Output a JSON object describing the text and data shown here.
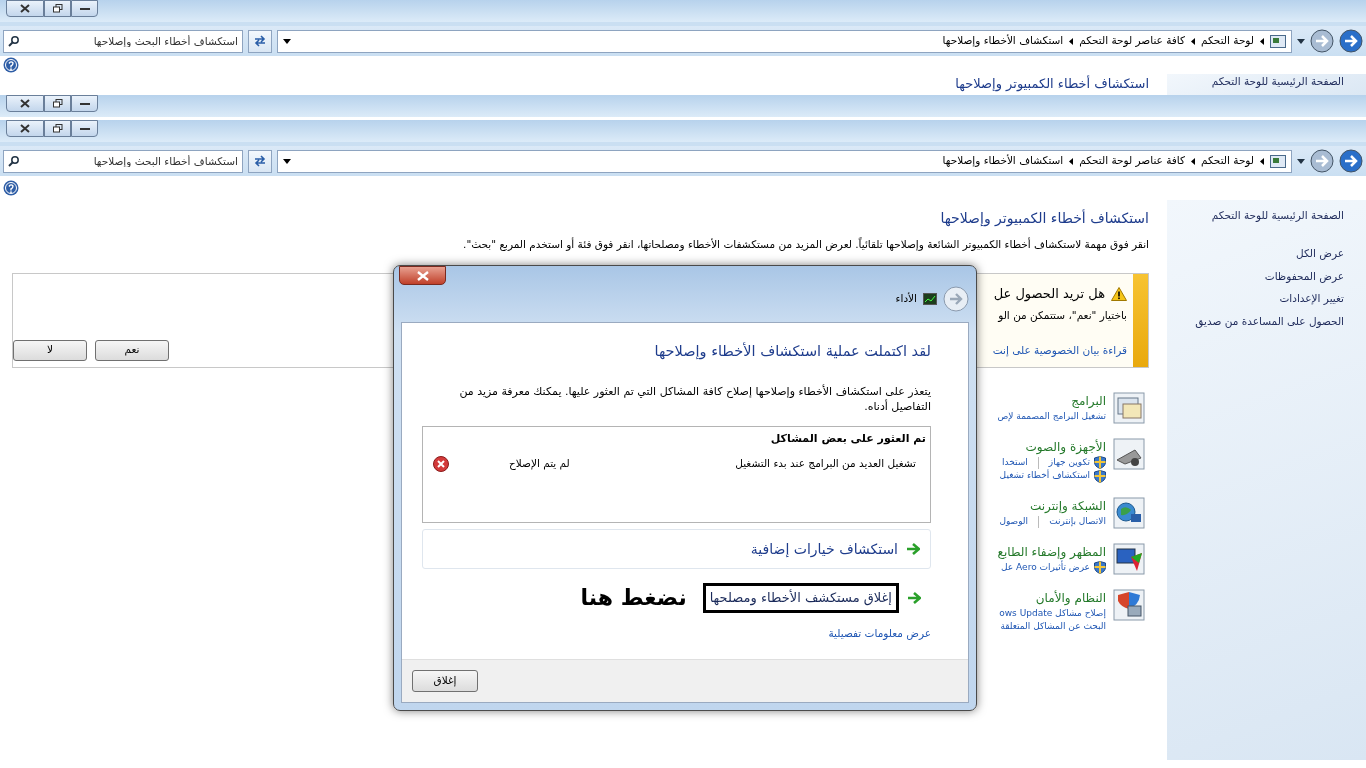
{
  "back_window": {
    "breadcrumbs": [
      "لوحة التحكم",
      "كافة عناصر لوحة التحكم",
      "استكشاف الأخطاء وإصلاحها"
    ],
    "search": {
      "placeholder": "استكشاف أخطاء البحث وإصلاحها"
    },
    "sidebar": {
      "home_link": "الصفحة الرئيسية للوحة التحكم"
    },
    "page_title": "استكشاف أخطاء الكمبيوتر وإصلاحها"
  },
  "front_window": {
    "breadcrumbs": [
      "لوحة التحكم",
      "كافة عناصر لوحة التحكم",
      "استكشاف الأخطاء وإصلاحها"
    ],
    "search": {
      "placeholder": "استكشاف أخطاء البحث وإصلاحها"
    },
    "sidebar": {
      "home_link": "الصفحة الرئيسية للوحة التحكم",
      "links": [
        "عرض الكل",
        "عرض المحفوظات",
        "تغيير الإعدادات",
        "الحصول على المساعدة من صديق"
      ]
    },
    "page_title": "استكشاف أخطاء الكمبيوتر وإصلاحها",
    "description": "انقر فوق مهمة لاستكشاف أخطاء الكمبيوتر الشائعة وإصلاحها تلقائياً. لعرض المزيد من مستكشفات الأخطاء ومصلحاتها، انقر فوق فئة أو استخدم المربع \"بحث\".",
    "infobar": {
      "title": "هل تريد الحصول عل",
      "text": "باختيار \"نعم\"، ستتمكن من الو",
      "link": "قراءة بيان الخصوصية على إنت",
      "buttons": [
        "نعم",
        "لا"
      ]
    },
    "categories": [
      {
        "kind": "programs",
        "title": "البرامج",
        "lines": [
          [
            {
              "text": "تشغيل البرامج المصممة لإص",
              "shield": false
            }
          ]
        ]
      },
      {
        "kind": "hardware",
        "title": "الأجهزة والصوت",
        "lines": [
          [
            {
              "text": "تكوين جهاز",
              "shield": true
            },
            {
              "text": "استخدا",
              "shield": false
            }
          ],
          [
            {
              "text": "استكشاف أخطاء تشغيل",
              "shield": true
            }
          ]
        ]
      },
      {
        "kind": "network",
        "title": "الشبكة وإنترنت",
        "lines": [
          [
            {
              "text": "الاتصال بإنترنت",
              "shield": false
            },
            {
              "text": "الوصول",
              "shield": false
            }
          ]
        ]
      },
      {
        "kind": "appearance",
        "title": "المظهر وإضفاء الطابع",
        "lines": [
          [
            {
              "text": "عرض تأثيرات Aero عل",
              "shield": true
            }
          ]
        ]
      },
      {
        "kind": "system",
        "title": "النظام والأمان",
        "lines": [
          [
            {
              "text": "إصلاح مشاكل ows Update",
              "shield": false
            }
          ],
          [
            {
              "text": "البحث عن المشاكل المتعلقة",
              "shield": false
            }
          ]
        ]
      }
    ]
  },
  "dialog": {
    "nav_title": "الأداء",
    "heading": "لقد اكتملت عملية استكشاف الأخطاء وإصلاحها",
    "message": "يتعذر على استكشاف الأخطاء وإصلاحها إصلاح كافة المشاكل التي تم العثور عليها. يمكنك معرفة مزيد من التفاصيل أدناه.",
    "results": {
      "heading": "تم العثور على بعض المشاكل",
      "rows": [
        {
          "problem": "تشغيل العديد من البرامج عند بدء التشغيل",
          "status": "لم يتم الإصلاح",
          "fixed": false
        }
      ]
    },
    "options": [
      {
        "label": "استكشاف خيارات إضافية",
        "kind": "boxed"
      },
      {
        "label": "إغلاق مستكشف الأخطاء ومصلحها",
        "kind": "highlighted",
        "annotation": "نضغط هنا"
      }
    ],
    "details_link": "عرض معلومات تفصيلية",
    "buttons": [
      "إغلاق"
    ]
  }
}
